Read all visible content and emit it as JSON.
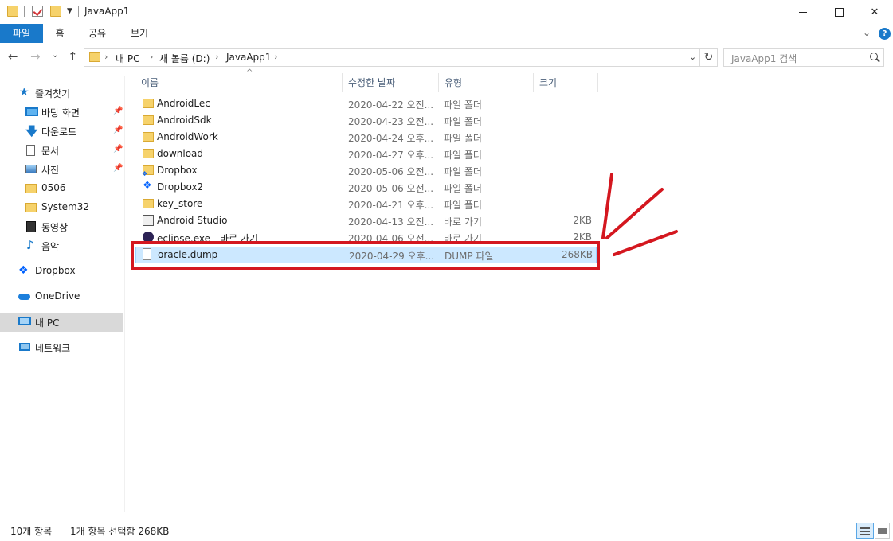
{
  "window": {
    "title": "JavaApp1",
    "close_glyph": "✕"
  },
  "ribbon": {
    "tabs": [
      "파일",
      "홈",
      "공유",
      "보기"
    ],
    "help_glyph": "?"
  },
  "address": {
    "crumbs": [
      "내 PC",
      "새 볼륨 (D:)",
      "JavaApp1"
    ],
    "separator": "›",
    "search_placeholder": "JavaApp1 검색"
  },
  "sidebar": {
    "quick_access": "즐겨찾기",
    "items": [
      {
        "label": "바탕 화면",
        "icon": "desktop-icon",
        "pinned": true
      },
      {
        "label": "다운로드",
        "icon": "download-icon",
        "pinned": true
      },
      {
        "label": "문서",
        "icon": "document-icon",
        "pinned": true
      },
      {
        "label": "사진",
        "icon": "pictures-icon",
        "pinned": true
      },
      {
        "label": "0506",
        "icon": "folder-icon",
        "pinned": false
      },
      {
        "label": "System32",
        "icon": "folder-icon",
        "pinned": false
      },
      {
        "label": "동영상",
        "icon": "video-icon",
        "pinned": false
      },
      {
        "label": "음악",
        "icon": "music-icon",
        "pinned": false
      }
    ],
    "locations": [
      {
        "label": "Dropbox",
        "icon": "dropbox-icon"
      },
      {
        "label": "OneDrive",
        "icon": "onedrive-icon"
      },
      {
        "label": "내 PC",
        "icon": "pc-icon",
        "selected": true
      },
      {
        "label": "네트워크",
        "icon": "network-icon"
      }
    ]
  },
  "columns": {
    "name": "이름",
    "date": "수정한 날짜",
    "type": "유형",
    "size": "크기"
  },
  "files": [
    {
      "name": "AndroidLec",
      "date": "2020-04-22 오전...",
      "type": "파일 폴더",
      "size": "",
      "icon": "folder-icon"
    },
    {
      "name": "AndroidSdk",
      "date": "2020-04-23 오전...",
      "type": "파일 폴더",
      "size": "",
      "icon": "folder-icon"
    },
    {
      "name": "AndroidWork",
      "date": "2020-04-24 오후...",
      "type": "파일 폴더",
      "size": "",
      "icon": "folder-icon"
    },
    {
      "name": "download",
      "date": "2020-04-27 오후...",
      "type": "파일 폴더",
      "size": "",
      "icon": "folder-icon"
    },
    {
      "name": "Dropbox",
      "date": "2020-05-06 오전...",
      "type": "파일 폴더",
      "size": "",
      "icon": "folder-dropbox-icon"
    },
    {
      "name": "Dropbox2",
      "date": "2020-05-06 오전...",
      "type": "파일 폴더",
      "size": "",
      "icon": "dropbox-icon"
    },
    {
      "name": "key_store",
      "date": "2020-04-21 오후...",
      "type": "파일 폴더",
      "size": "",
      "icon": "folder-icon"
    },
    {
      "name": "Android Studio",
      "date": "2020-04-13 오전...",
      "type": "바로 가기",
      "size": "2KB",
      "icon": "shortcut-icon"
    },
    {
      "name": "eclipse.exe - 바로 가기",
      "date": "2020-04-06 오전...",
      "type": "바로 가기",
      "size": "2KB",
      "icon": "eclipse-icon"
    },
    {
      "name": "oracle.dump",
      "date": "2020-04-29 오후...",
      "type": "DUMP 파일",
      "size": "268KB",
      "icon": "file-icon",
      "selected": true
    }
  ],
  "status": {
    "item_count": "10개 항목",
    "selection": "1개 항목 선택함 268KB"
  },
  "colors": {
    "accent": "#1979ca",
    "selection": "#cce8ff",
    "annotation": "#d4171f"
  }
}
